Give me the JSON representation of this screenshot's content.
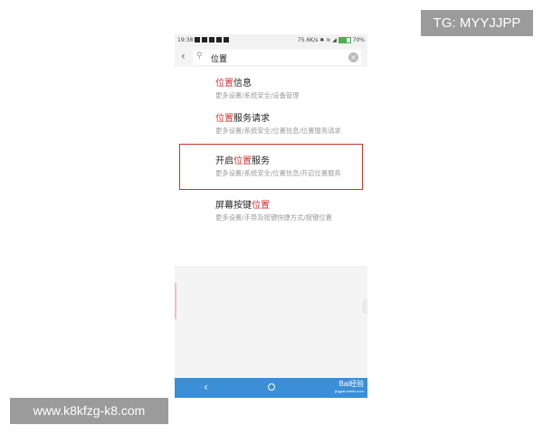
{
  "overlay": {
    "tg_label": "TG: MYYJJPP",
    "site_label": "www.k8kfzg-k8.com"
  },
  "status_bar": {
    "time": "19:38",
    "speed": "75.6K/s",
    "battery": "70%"
  },
  "search": {
    "query": "位置"
  },
  "results": [
    {
      "title_pre": "",
      "title_hl": "位置",
      "title_post": "信息",
      "path": "更多设置/系统安全/设备管理"
    },
    {
      "title_pre": "",
      "title_hl": "位置",
      "title_post": "服务请求",
      "path": "更多设置/系统安全/位置信息/位置服务请求"
    },
    {
      "title_pre": "开启",
      "title_hl": "位置",
      "title_post": "服务",
      "path": "更多设置/系统安全/位置信息/开启位置服务"
    },
    {
      "title_pre": "屏幕按键",
      "title_hl": "位置",
      "title_post": "",
      "path": "更多设置/手势及按键快捷方式/按键位置"
    }
  ],
  "nav": {
    "watermark": "Bai经验",
    "watermark_sub": "jingyan.baidu.com"
  },
  "colors": {
    "highlight": "#d32f2f",
    "nav_bar": "#3a8fd6",
    "annotation_box": "#c0392b"
  }
}
